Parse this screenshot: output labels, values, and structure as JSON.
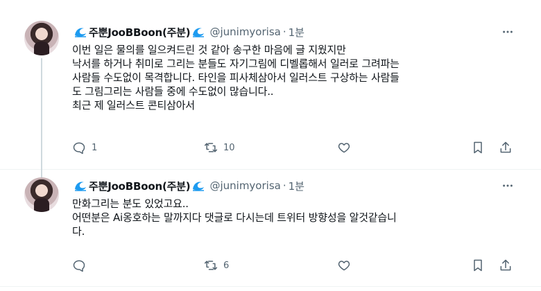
{
  "tweets": [
    {
      "display_name": "주뿐JooBBoon(주분)",
      "handle": "@junimyorisa",
      "separator": "·",
      "time": "1분",
      "text": "이번 일은 물의를 일으켜드린 것 같아 송구한 마음에 글 지웠지만\n낙서를 하거나 취미로 그리는 분들도 자기그림에 디벨롭해서 일러로 그려파는\n사람들 수도없이 목격합니다. 타인을 피사체삼아서 일러스트 구상하는 사람들\n도 그림그리는 사람들 중에 수도없이 많습니다..\n최근 제 일러스트 콘티삼아서",
      "reply_count": "1",
      "retweet_count": "10",
      "like_count": "",
      "icons": [
        "reply-icon",
        "retweet-icon",
        "like-icon",
        "bookmark-icon",
        "share-icon"
      ]
    },
    {
      "display_name": "주뿐JooBBoon(주분)",
      "handle": "@junimyorisa",
      "separator": "·",
      "time": "1분",
      "text": "만화그리는 분도 있었고요..\n어떤분은 Ai옹호하는 말까지다 댓글로 다시는데 트위터 방향성을 알것같습니\n다.",
      "reply_count": "",
      "retweet_count": "6",
      "like_count": "",
      "icons": [
        "reply-icon",
        "retweet-icon",
        "like-icon",
        "bookmark-icon",
        "share-icon"
      ]
    }
  ],
  "colors": {
    "text_primary": "#0f1419",
    "text_secondary": "#536471",
    "divider": "#eff3f4",
    "thread_line": "#cfd9de",
    "wave_emoji": "#1d9bf0"
  }
}
